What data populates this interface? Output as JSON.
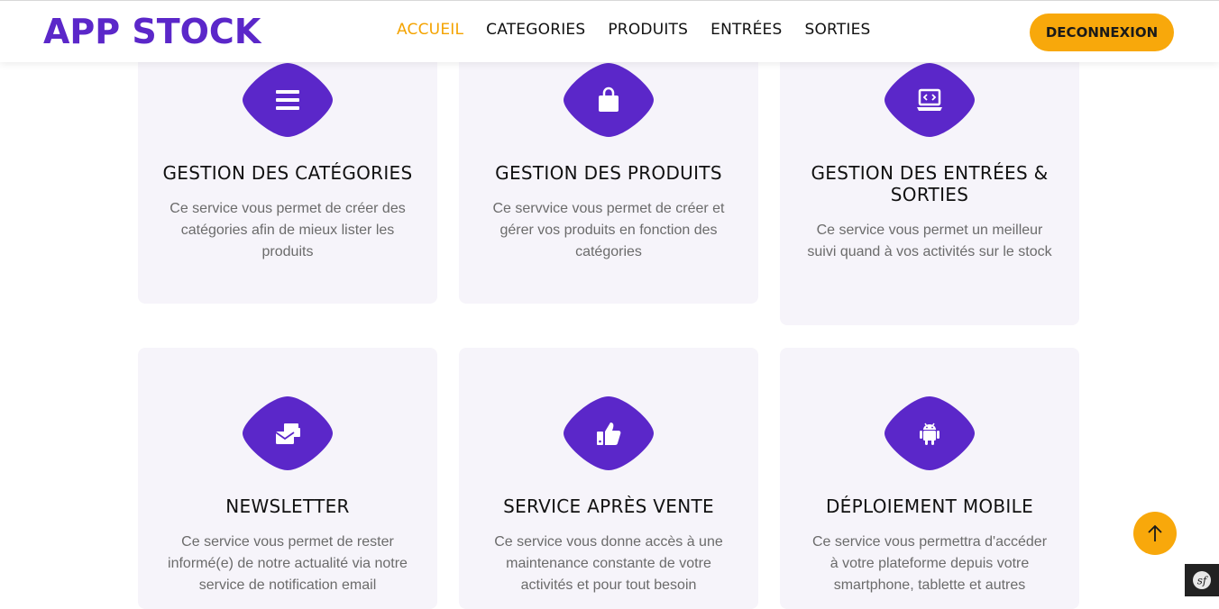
{
  "header": {
    "brand": "APP STOCK",
    "nav": [
      {
        "label": "ACCUEIL",
        "active": true
      },
      {
        "label": "CATEGORIES",
        "active": false
      },
      {
        "label": "PRODUITS",
        "active": false
      },
      {
        "label": "ENTRÉES",
        "active": false
      },
      {
        "label": "SORTIES",
        "active": false
      }
    ],
    "logout_label": "DECONNEXION"
  },
  "colors": {
    "brand": "#5b27c9",
    "accent": "#f8a80b",
    "card_bg": "#f6f4fa"
  },
  "services": [
    {
      "icon": "list-icon",
      "title": "GESTION DES CATÉGORIES",
      "description": "Ce service vous permet de créer des catégories afin de mieux lister les produits"
    },
    {
      "icon": "shopping-bag-icon",
      "title": "GESTION DES PRODUITS",
      "description": "Ce servvice vous permet de créer et gérer vos produits en fonction des catégories"
    },
    {
      "icon": "laptop-code-icon",
      "title": "GESTION DES ENTRÉES & SORTIES",
      "description": "Ce service vous permet un meilleur suivi quand à vos activités sur le stock"
    },
    {
      "icon": "envelope-icon",
      "title": "NEWSLETTER",
      "description": "Ce service vous permet de rester informé(e) de notre actualité via notre service de notification email"
    },
    {
      "icon": "thumbs-up-icon",
      "title": "SERVICE APRÈS VENTE",
      "description": "Ce service vous donne accès à une maintenance constante de votre activités et pour tout besoin"
    },
    {
      "icon": "android-icon",
      "title": "DÉPLOIEMENT MOBILE",
      "description": "Ce service vous permettra d'accéder à votre plateforme depuis votre smartphone, tablette et autres"
    }
  ],
  "back_to_top_icon": "arrow-up-icon",
  "debug_badge_icon": "symfony-icon"
}
